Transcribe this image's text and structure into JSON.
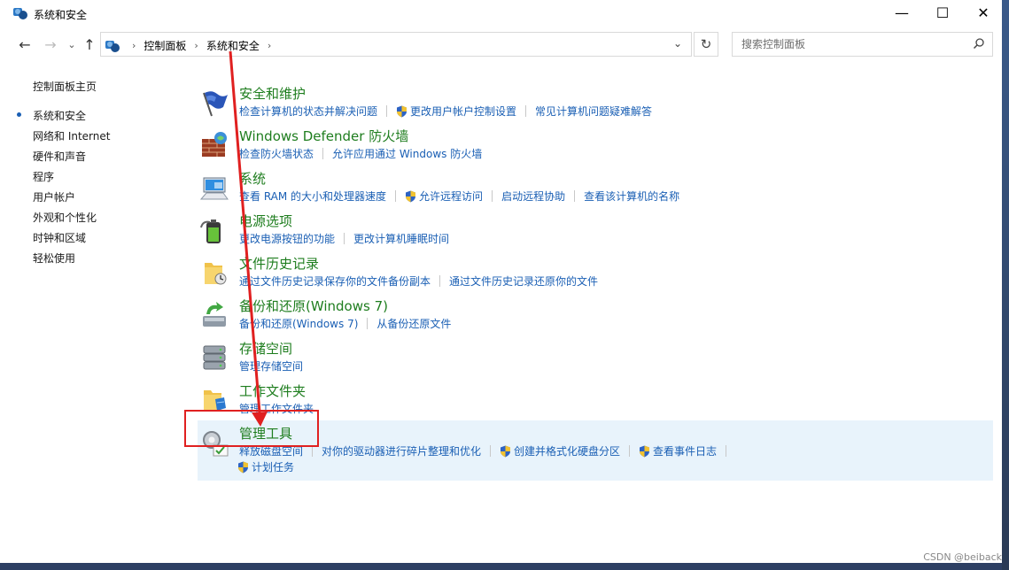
{
  "window": {
    "title": "系统和安全",
    "minimize": "—",
    "maximize": "☐",
    "close": "✕"
  },
  "nav": {
    "back": "←",
    "forward": "→",
    "recent": "⌄",
    "up": "↑",
    "breadcrumbs": [
      "控制面板",
      "系统和安全"
    ],
    "refresh": "↻",
    "dropdown": "⌄"
  },
  "search": {
    "placeholder": "搜索控制面板"
  },
  "sidebar": {
    "items": [
      {
        "label": "控制面板主页"
      },
      {
        "label": "系统和安全",
        "current": true
      },
      {
        "label": "网络和 Internet"
      },
      {
        "label": "硬件和声音"
      },
      {
        "label": "程序"
      },
      {
        "label": "用户帐户"
      },
      {
        "label": "外观和个性化"
      },
      {
        "label": "时钟和区域"
      },
      {
        "label": "轻松使用"
      }
    ]
  },
  "categories": [
    {
      "title": "安全和维护",
      "links": [
        "检查计算机的状态并解决问题",
        "更改用户帐户控制设置",
        "常见计算机问题疑难解答"
      ],
      "shield": [
        false,
        true,
        false
      ]
    },
    {
      "title": "Windows Defender 防火墙",
      "links": [
        "检查防火墙状态",
        "允许应用通过 Windows 防火墙"
      ],
      "shield": [
        false,
        false
      ]
    },
    {
      "title": "系统",
      "links": [
        "查看 RAM 的大小和处理器速度",
        "允许远程访问",
        "启动远程协助",
        "查看该计算机的名称"
      ],
      "shield": [
        false,
        true,
        false,
        false
      ]
    },
    {
      "title": "电源选项",
      "links": [
        "更改电源按钮的功能",
        "更改计算机睡眠时间"
      ],
      "shield": [
        false,
        false
      ]
    },
    {
      "title": "文件历史记录",
      "links": [
        "通过文件历史记录保存你的文件备份副本",
        "通过文件历史记录还原你的文件"
      ],
      "shield": [
        false,
        false
      ]
    },
    {
      "title": "备份和还原(Windows 7)",
      "links": [
        "备份和还原(Windows 7)",
        "从备份还原文件"
      ],
      "shield": [
        false,
        false
      ]
    },
    {
      "title": "存储空间",
      "links": [
        "管理存储空间"
      ],
      "shield": [
        false
      ]
    },
    {
      "title": "工作文件夹",
      "links": [
        "管理工作文件夹"
      ],
      "shield": [
        false
      ]
    },
    {
      "title": "管理工具",
      "links": [
        "释放磁盘空间",
        "对你的驱动器进行碎片整理和优化",
        "创建并格式化硬盘分区",
        "查看事件日志"
      ],
      "shield": [
        false,
        false,
        true,
        true
      ],
      "links2": [
        "计划任务"
      ],
      "highlight": true
    }
  ],
  "watermark": "CSDN @beiback",
  "colors": {
    "link": "#1a5fb4",
    "category_title": "#1e7d1e",
    "highlight_bg": "#e8f3fb",
    "annotation_red": "#e02020"
  }
}
